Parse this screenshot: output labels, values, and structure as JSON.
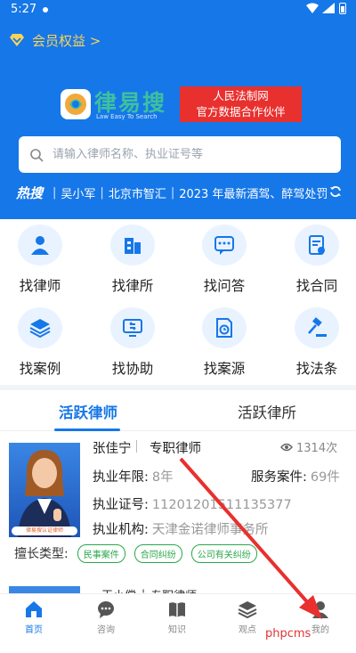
{
  "status_bar": {
    "time": "5:27"
  },
  "member": {
    "label": "会员权益 >"
  },
  "logo": {
    "text": "律易搜",
    "sub": "Law Easy To Search"
  },
  "partner": {
    "line1": "人民法制网",
    "line2": "官方数据合作伙伴"
  },
  "search": {
    "placeholder": "请输入律师名称、执业证号等"
  },
  "hot": {
    "label": "热搜",
    "items": [
      "吴小军",
      "北京市智汇",
      "2023 年最新酒驾、醉驾处罚"
    ]
  },
  "functions": [
    {
      "label": "找律师",
      "icon": "lawyer-icon"
    },
    {
      "label": "找律所",
      "icon": "building-icon"
    },
    {
      "label": "找问答",
      "icon": "chat-icon"
    },
    {
      "label": "找合同",
      "icon": "contract-icon"
    },
    {
      "label": "找案例",
      "icon": "layers-icon"
    },
    {
      "label": "找协助",
      "icon": "assist-icon"
    },
    {
      "label": "找案源",
      "icon": "case-source-icon"
    },
    {
      "label": "找法条",
      "icon": "gavel-icon"
    }
  ],
  "tabs": [
    {
      "label": "活跃律师",
      "active": true
    },
    {
      "label": "活跃律所",
      "active": false
    }
  ],
  "lawyer": {
    "name": "张佳宁",
    "title": "专职律师",
    "views": "1314次",
    "photo_tag": "律易搜认证律师",
    "years_label": "执业年限:",
    "years_value": "8年",
    "cases_label": "服务案件:",
    "cases_value": "69件",
    "license_label": "执业证号:",
    "license_value": "11201201511135377",
    "firm_label": "执业机构:",
    "firm_value": "天津金诺律师事务所",
    "specialty_label": "擅长类型:",
    "specialties": [
      "民事案件",
      "合同纠纷",
      "公司有关纠纷"
    ]
  },
  "next_lawyer": {
    "text": "王小偿 ┆ 专职律师"
  },
  "bottom_nav": [
    {
      "label": "首页",
      "icon": "home-icon",
      "active": true
    },
    {
      "label": "咨询",
      "icon": "consult-icon",
      "active": false
    },
    {
      "label": "知识",
      "icon": "book-icon",
      "active": false
    },
    {
      "label": "观点",
      "icon": "view-icon",
      "active": false
    },
    {
      "label": "我的",
      "icon": "profile-icon",
      "active": false
    }
  ],
  "watermark": "phpcms",
  "colors": {
    "primary": "#1677e8",
    "partner_red": "#e8302e",
    "chip_green": "#2aa84a",
    "gold": "#f8d35a"
  }
}
